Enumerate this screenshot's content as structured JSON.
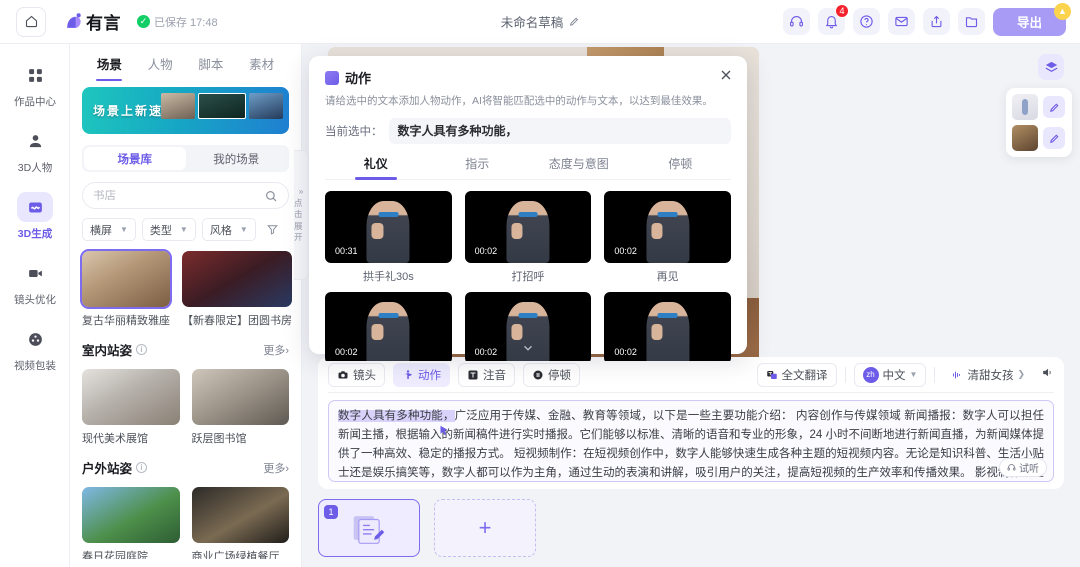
{
  "topbar": {
    "home_icon": "home-icon",
    "brand": "有言",
    "save_status": "已保存 17:48",
    "doc_title": "未命名草稿",
    "actions": [
      {
        "name": "headset-icon",
        "badge": ""
      },
      {
        "name": "bell-icon",
        "badge": "4"
      },
      {
        "name": "help-icon",
        "badge": ""
      },
      {
        "name": "mail-icon",
        "badge": ""
      },
      {
        "name": "share-icon",
        "badge": ""
      },
      {
        "name": "folder-icon",
        "badge": ""
      }
    ],
    "export_label": "导出",
    "accent": "#6c5ce7"
  },
  "rail": {
    "items": [
      {
        "label": "作品中心",
        "icon": "grid-icon",
        "active": false
      },
      {
        "label": "3D人物",
        "icon": "avatar-icon",
        "active": false
      },
      {
        "label": "3D生成",
        "icon": "wave-icon",
        "active": true
      },
      {
        "label": "镜头优化",
        "icon": "camera-icon",
        "active": false
      },
      {
        "label": "视频包装",
        "icon": "film-icon",
        "active": false
      }
    ]
  },
  "panel": {
    "tabs": [
      {
        "label": "场景",
        "active": true
      },
      {
        "label": "人物",
        "active": false
      },
      {
        "label": "脚本",
        "active": false
      },
      {
        "label": "素材",
        "active": false
      }
    ],
    "banner_title": "场景上新速达",
    "segments": [
      {
        "label": "场景库",
        "active": true
      },
      {
        "label": "我的场景",
        "active": false
      }
    ],
    "search_placeholder": "书店",
    "search_value": "",
    "filters": [
      {
        "label": "横屏"
      },
      {
        "label": "类型"
      },
      {
        "label": "风格"
      }
    ],
    "filter_icon": "funnel-icon",
    "collapse_hint": "点击展开",
    "sections": [
      {
        "title": "",
        "more": "",
        "items": [
          {
            "name": "复古华丽精致雅座",
            "selected": true,
            "style": "scene-a"
          },
          {
            "name": "【新春限定】团圆书房",
            "selected": false,
            "style": "scene-b"
          }
        ]
      },
      {
        "title": "室内站姿",
        "more": "更多›",
        "items": [
          {
            "name": "现代美术展馆",
            "selected": false,
            "style": "scene-c"
          },
          {
            "name": "跃层图书馆",
            "selected": false,
            "style": "scene-d"
          }
        ]
      },
      {
        "title": "户外站姿",
        "more": "更多›",
        "items": [
          {
            "name": "春日花园庭院",
            "selected": false,
            "style": "scene-e"
          },
          {
            "name": "商业广场绿植餐厅",
            "selected": false,
            "style": "scene-f"
          }
        ]
      }
    ]
  },
  "stage": {
    "layers_icon": "layers-icon",
    "layers": [
      {
        "name": "character-layer",
        "edit_icon": "pencil-icon"
      },
      {
        "name": "scene-layer",
        "edit_icon": "pencil-icon"
      }
    ]
  },
  "editor": {
    "tools": [
      {
        "label": "镜头",
        "icon": "camera-icon",
        "active": false
      },
      {
        "label": "动作",
        "icon": "action-icon",
        "active": true
      },
      {
        "label": "注音",
        "icon": "pinyin-icon",
        "active": false
      },
      {
        "label": "停顿",
        "icon": "pause-icon",
        "active": false
      }
    ],
    "translate_label": "全文翻译",
    "language_label": "中文",
    "language_code": "zh",
    "voice_label": "清甜女孩",
    "audition_label": "试听",
    "script_highlight": "数字人具有多种功能，",
    "script_rest": "广泛应用于传媒、金融、教育等领域，以下是一些主要功能介绍： 内容创作与传媒领域 新闻播报：数字人可以担任新闻主播，根据输入的新闻稿件进行实时播报。它们能够以标准、清晰的语音和专业的形象，24 小时不间断地进行新闻直播，为新闻媒体提供了一种高效、稳定的播报方式。 短视频制作：在短视频创作中，数字人能够快速生成各种主题的短视频内容。无论是知识科普、生活小贴士还是娱乐搞笑等，数字人都可以作为主角，通过生动的表演和讲解，吸引用户的关注，提高短视频的生产效率和传播效果。 影视制作：在影视制作中，数字人可以扮演各种角色"
  },
  "timeline": {
    "scene_number": "1",
    "add_label": "+"
  },
  "modal": {
    "title": "动作",
    "description": "请给选中的文本添加人物动作，AI将智能匹配选中的动作与文本，以达到最佳效果。",
    "selection_label": "当前选中：",
    "selection_value": "数字人具有多种功能，",
    "close_icon": "close-icon",
    "tabs": [
      {
        "label": "礼仪",
        "active": true
      },
      {
        "label": "指示",
        "active": false
      },
      {
        "label": "态度与意图",
        "active": false
      },
      {
        "label": "停顿",
        "active": false
      }
    ],
    "actions": [
      {
        "name": "拱手礼30s",
        "duration": "00:31"
      },
      {
        "name": "打招呼",
        "duration": "00:02"
      },
      {
        "name": "再见",
        "duration": "00:02"
      },
      {
        "name": "",
        "duration": "00:02"
      },
      {
        "name": "",
        "duration": "00:02"
      },
      {
        "name": "",
        "duration": "00:02"
      }
    ]
  }
}
